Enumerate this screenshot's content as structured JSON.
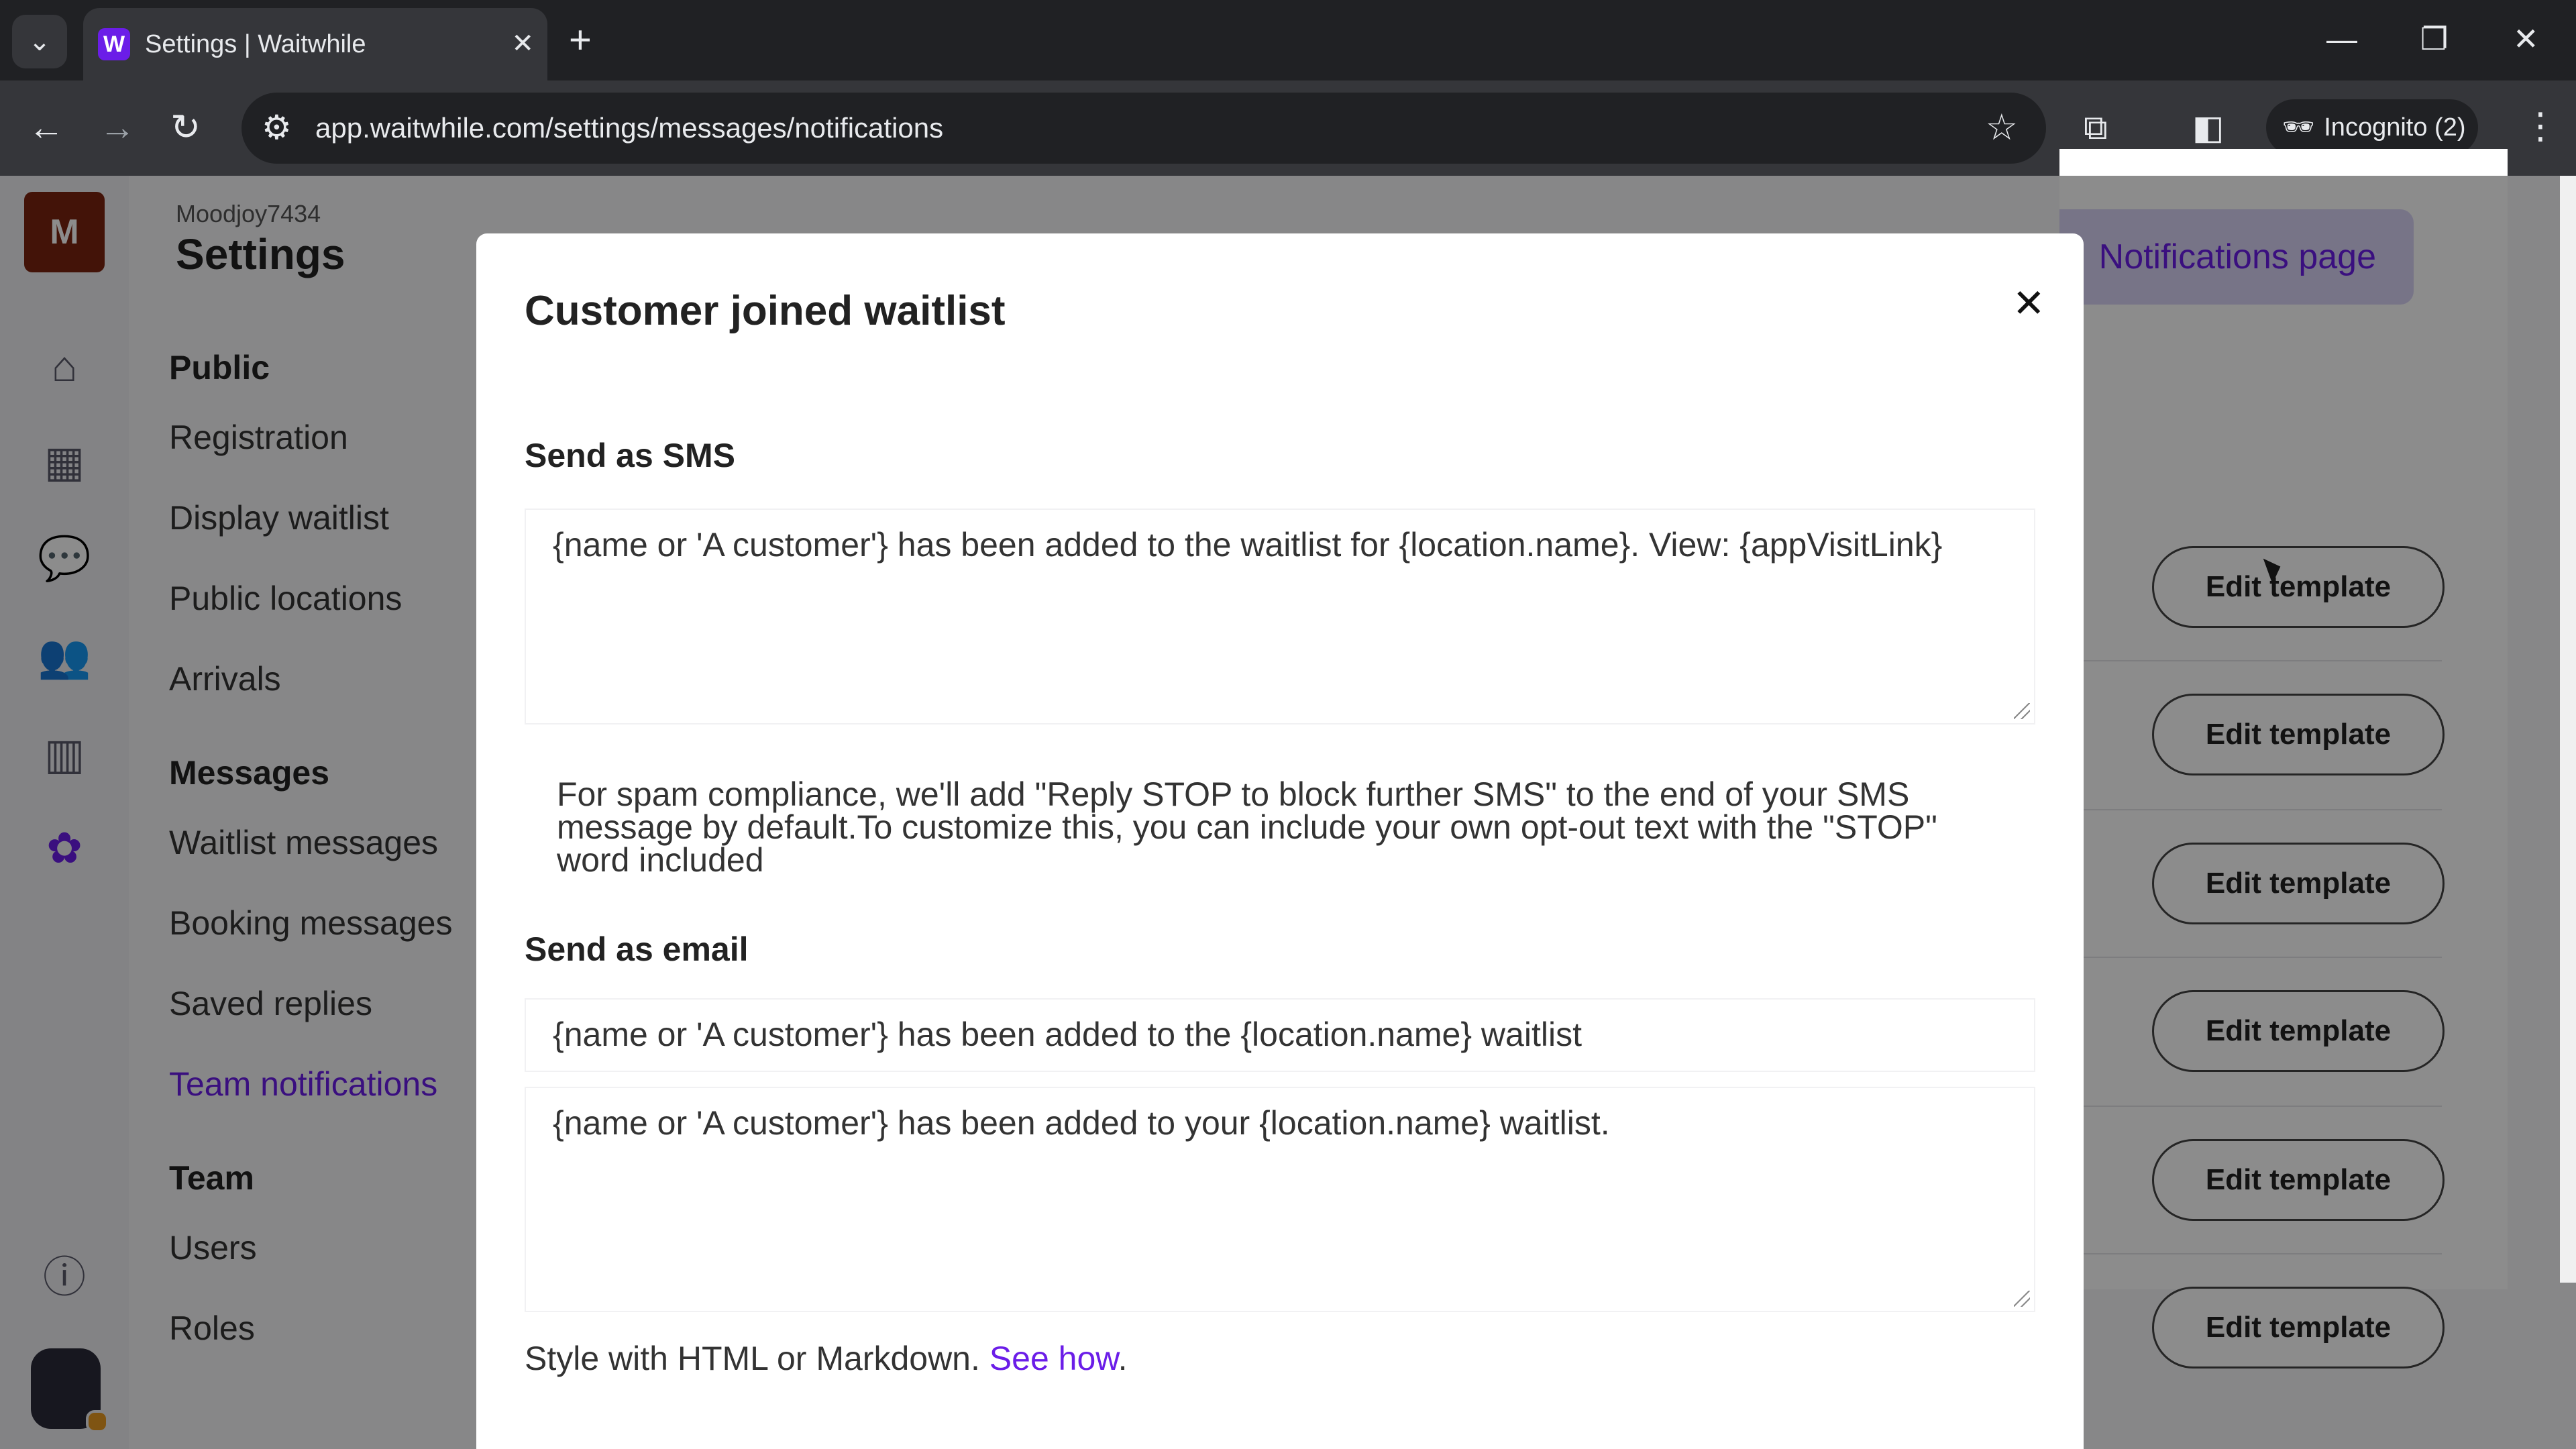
{
  "browser": {
    "tab_title": "Settings | Waitwhile",
    "favicon_letter": "W",
    "url": "app.waitwhile.com/settings/messages/notifications",
    "profile_label": "Incognito (2)",
    "icons": {
      "tab_search": "chevron-down-icon",
      "close_tab": "close-icon",
      "new_tab": "plus-icon",
      "minimize": "minimize-icon",
      "restore": "restore-icon",
      "close_window": "close-icon",
      "back": "arrow-left-icon",
      "forward": "arrow-right-icon",
      "reload": "reload-icon",
      "site_info": "tune-icon",
      "bookmark": "star-icon",
      "extensions": "puzzle-icon",
      "side_panel": "side-panel-icon",
      "incognito": "incognito-icon",
      "menu": "more-vert-icon"
    }
  },
  "rail": {
    "account_letter": "M",
    "icons": [
      "home-icon",
      "calendar-icon",
      "chat-icon",
      "users-icon",
      "analytics-icon",
      "settings-icon",
      "help-icon"
    ],
    "active_icon": "settings-icon",
    "accent": "#6b1de8"
  },
  "header": {
    "org_name": "Moodjoy7434",
    "title": "Settings"
  },
  "settings_nav": {
    "public_heading": "Public",
    "public_items": [
      "Registration",
      "Display waitlist",
      "Public locations",
      "Arrivals"
    ],
    "messages_heading": "Messages",
    "messages_items": [
      "Waitlist messages",
      "Booking messages",
      "Saved replies",
      "Team notifications"
    ],
    "active_item": "Team notifications",
    "team_heading": "Team",
    "team_items": [
      "Users",
      "Roles"
    ]
  },
  "background_panel": {
    "notifications_page_label": "Notifications page",
    "edit_template_label": "Edit template"
  },
  "modal": {
    "title": "Customer joined waitlist",
    "close_icon": "close-icon",
    "sms_label": "Send as SMS",
    "sms_text": "{name or 'A customer'} has been added to the waitlist for {location.name}. View: {appVisitLink}",
    "compliance_note": "For spam compliance, we'll add \"Reply STOP to block further SMS\" to the end of your SMS message by default.To customize this, you can include your own opt-out text with the \"STOP\" word included",
    "email_label": "Send as email",
    "email_subject": "{name or 'A customer'} has been added to the {location.name} waitlist",
    "email_body": "{name or 'A customer'} has been added to your {location.name} waitlist.",
    "style_note": "Style with HTML or Markdown.",
    "style_link": "See how",
    "style_period": "."
  }
}
